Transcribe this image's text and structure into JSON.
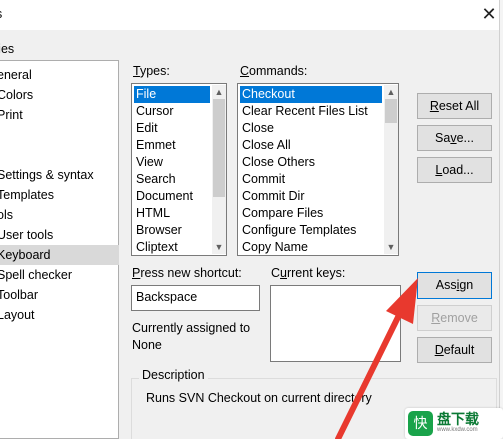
{
  "window": {
    "title": "Preferences",
    "title_visible": "ces",
    "close_glyph": "✕"
  },
  "categories": {
    "label": "ries",
    "items": [
      {
        "label": "eneral"
      },
      {
        "label": "Colors"
      },
      {
        "label": "Print"
      },
      {
        "label": ""
      },
      {
        "label": "Settings & syntax"
      },
      {
        "label": "Templates"
      },
      {
        "label": "ols"
      },
      {
        "label": "User tools"
      },
      {
        "label": "Keyboard",
        "selected": true
      },
      {
        "label": "Spell checker"
      },
      {
        "label": "Toolbar"
      },
      {
        "label": "Layout"
      }
    ]
  },
  "types": {
    "label_accel": "T",
    "label_rest": "ypes:",
    "items": [
      "File",
      "Cursor",
      "Edit",
      "Emmet",
      "View",
      "Search",
      "Document",
      "HTML",
      "Browser",
      "Cliptext"
    ],
    "selected_index": 0
  },
  "commands": {
    "label_accel": "C",
    "label_rest": "ommands:",
    "items": [
      "Checkout",
      "Clear Recent Files List",
      "Close",
      "Close All",
      "Close Others",
      "Commit",
      "Commit Dir",
      "Compare Files",
      "Configure Templates",
      "Copy Name"
    ],
    "selected_index": 0
  },
  "shortcut": {
    "label_accel": "P",
    "label_rest": "ress new shortcut:",
    "value": "Backspace",
    "assigned_label": "Currently assigned to",
    "assigned_value": "None"
  },
  "current_keys": {
    "label_pre": "C",
    "label_accel": "u",
    "label_rest": "rrent keys:"
  },
  "buttons": {
    "reset_all": {
      "accel": "R",
      "rest": "eset All"
    },
    "save": {
      "pre": "Sa",
      "accel": "v",
      "rest": "e..."
    },
    "load": {
      "accel": "L",
      "rest": "oad..."
    },
    "assign": {
      "pre": "Ass",
      "accel": "i",
      "rest": "gn"
    },
    "remove": {
      "accel": "R",
      "rest": "emove"
    },
    "default": {
      "accel": "D",
      "rest": "efault"
    }
  },
  "description": {
    "title": "Description",
    "text": "Runs SVN Checkout on current directory"
  },
  "watermark": {
    "mark": "快",
    "text": "盘下载",
    "sub": "www.kxdw.com"
  },
  "colors": {
    "selection": "#0078d7",
    "annotation_arrow": "#e8392e",
    "watermark_green": "#19a34a"
  }
}
